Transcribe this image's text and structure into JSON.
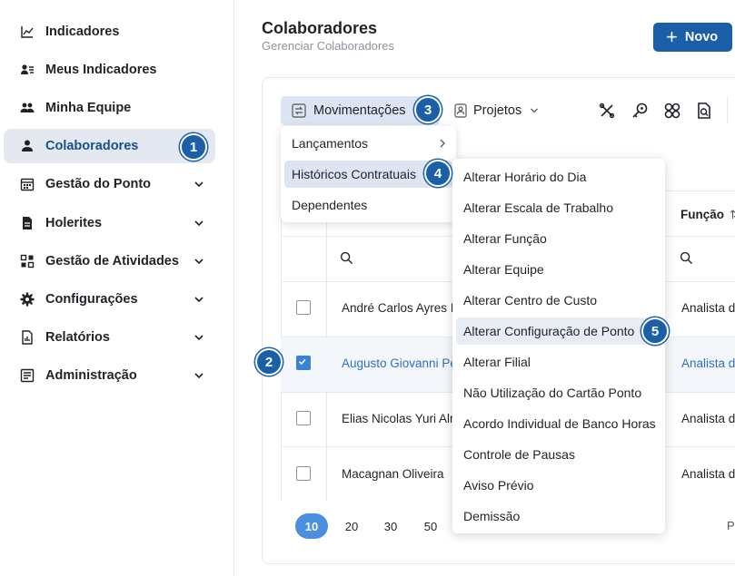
{
  "sidebar": {
    "items": [
      {
        "label": "Indicadores"
      },
      {
        "label": "Meus Indicadores"
      },
      {
        "label": "Minha Equipe"
      },
      {
        "label": "Colaboradores"
      },
      {
        "label": "Gestão do Ponto"
      },
      {
        "label": "Holerites"
      },
      {
        "label": "Gestão de Atividades"
      },
      {
        "label": "Configurações"
      },
      {
        "label": "Relatórios"
      },
      {
        "label": "Administração"
      }
    ]
  },
  "header": {
    "title": "Colaboradores",
    "subtitle": "Gerenciar Colaboradores",
    "new_label": "Novo"
  },
  "toolbar": {
    "movimentacoes_label": "Movimentações",
    "projetos_label": "Projetos"
  },
  "table": {
    "func_header": "Função",
    "rows": [
      {
        "name": "André Carlos Ayres I",
        "func": "Analista d",
        "checked": false
      },
      {
        "name": "Augusto Giovanni Pe",
        "func": "Analista d",
        "checked": true
      },
      {
        "name": "Elias Nicolas Yuri Alr",
        "func": "Analista d",
        "checked": false
      },
      {
        "name": "Macagnan Oliveira",
        "func": "Analista d",
        "checked": false
      }
    ]
  },
  "pager": {
    "sizes": [
      "10",
      "20",
      "30",
      "50"
    ],
    "active": "10",
    "trailing": "P"
  },
  "menu1": {
    "items": [
      {
        "label": "Lançamentos"
      },
      {
        "label": "Históricos Contratuais"
      },
      {
        "label": "Dependentes"
      }
    ]
  },
  "menu2": {
    "items": [
      {
        "label": "Alterar Horário do Dia"
      },
      {
        "label": "Alterar Escala de Trabalho"
      },
      {
        "label": "Alterar Função"
      },
      {
        "label": "Alterar Equipe"
      },
      {
        "label": "Alterar Centro de Custo"
      },
      {
        "label": "Alterar Configuração de Ponto"
      },
      {
        "label": "Alterar Filial"
      },
      {
        "label": "Não Utilização do Cartão Ponto"
      },
      {
        "label": "Acordo Individual de Banco Horas"
      },
      {
        "label": "Controle de Pausas"
      },
      {
        "label": "Aviso Prévio"
      },
      {
        "label": "Demissão"
      }
    ]
  },
  "badges": [
    "1",
    "2",
    "3",
    "4",
    "5"
  ],
  "colors": {
    "primary": "#1a5fa8",
    "link": "#2f6fc4",
    "highlight": "#dde5f2",
    "pager_active": "#4a8fe0"
  }
}
